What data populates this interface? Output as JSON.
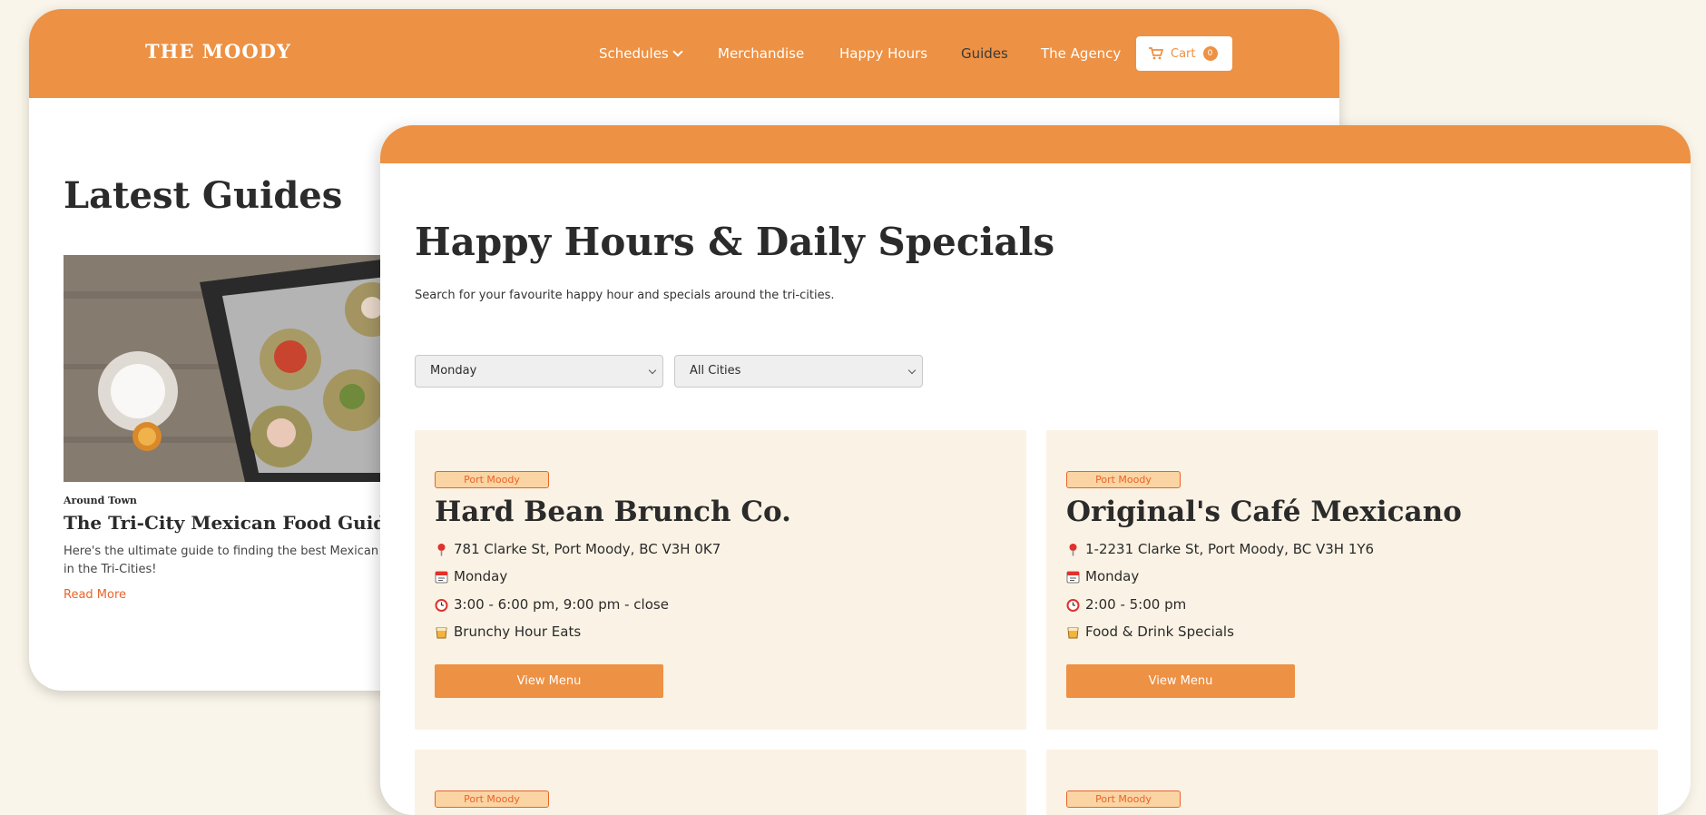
{
  "back": {
    "logo": "THE MOODY",
    "nav": {
      "schedules": "Schedules",
      "merchandise": "Merchandise",
      "happy_hours": "Happy Hours",
      "guides": "Guides",
      "agency": "The Agency"
    },
    "cart": {
      "label": "Cart",
      "count": "0"
    },
    "section_title": "Latest Guides",
    "guide": {
      "category": "Around Town",
      "title": "The Tri-City Mexican Food Guide",
      "description": "Here's the ultimate guide to finding the best Mexican food in the Tri-Cities!",
      "read_more": "Read More"
    }
  },
  "front": {
    "title": "Happy Hours & Daily Specials",
    "subtitle": "Search for your favourite happy hour and specials around the tri-cities.",
    "filters": {
      "day": "Monday",
      "city": "All Cities"
    },
    "cards": [
      {
        "city": "Port Moody",
        "name": "Hard Bean Brunch Co.",
        "address": "781 Clarke St, Port Moody, BC V3H 0K7",
        "day": "Monday",
        "time": "3:00 - 6:00 pm, 9:00 pm - close",
        "special": "Brunchy Hour Eats",
        "button": "View Menu"
      },
      {
        "city": "Port Moody",
        "name": "Original's Café Mexicano",
        "address": "1-2231 Clarke St, Port Moody, BC V3H 1Y6",
        "day": "Monday",
        "time": "2:00 - 5:00 pm",
        "special": "Food & Drink Specials",
        "button": "View Menu"
      },
      {
        "city": "Port Moody"
      },
      {
        "city": "Port Moody"
      }
    ]
  },
  "colors": {
    "accent": "#ed9144",
    "link": "#e8642a",
    "background": "#faf5ea",
    "card": "#faf2e4",
    "badge_fill": "#fbd4a3"
  },
  "icons": {
    "address": "round-pushpin-icon",
    "day": "calendar-icon",
    "time": "alarm-clock-icon",
    "special": "drink-glass-icon",
    "cart": "shopping-cart-icon"
  }
}
